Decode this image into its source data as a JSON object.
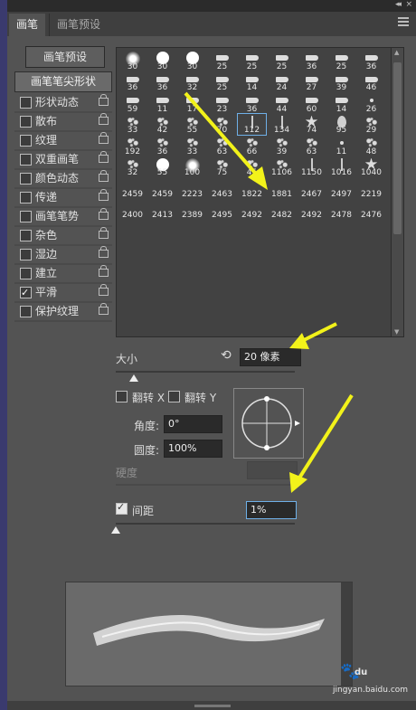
{
  "window": {
    "collapse_glyph": "◂◂",
    "close_glyph": "×"
  },
  "tabs": [
    {
      "label": "画笔",
      "active": true
    },
    {
      "label": "画笔预设",
      "active": false
    }
  ],
  "preset_button": "画笔预设",
  "sidebar": {
    "header": "画笔笔尖形状",
    "items": [
      {
        "label": "形状动态",
        "checked": false
      },
      {
        "label": "散布",
        "checked": false
      },
      {
        "label": "纹理",
        "checked": false
      },
      {
        "label": "双重画笔",
        "checked": false
      },
      {
        "label": "颜色动态",
        "checked": false
      },
      {
        "label": "传递",
        "checked": false
      },
      {
        "label": "画笔笔势",
        "checked": false
      },
      {
        "label": "杂色",
        "checked": false
      },
      {
        "label": "湿边",
        "checked": false
      },
      {
        "label": "建立",
        "checked": false
      },
      {
        "label": "平滑",
        "checked": true
      },
      {
        "label": "保护纹理",
        "checked": false
      }
    ]
  },
  "brush_tips": [
    {
      "size": "30",
      "shape": "soft"
    },
    {
      "size": "30",
      "shape": "round"
    },
    {
      "size": "30",
      "shape": "round"
    },
    {
      "size": "25",
      "shape": "tip"
    },
    {
      "size": "25",
      "shape": "tip"
    },
    {
      "size": "25",
      "shape": "tip"
    },
    {
      "size": "36",
      "shape": "tip"
    },
    {
      "size": "25",
      "shape": "tip"
    },
    {
      "size": "36",
      "shape": "tip"
    },
    {
      "size": "36",
      "shape": "tip"
    },
    {
      "size": "36",
      "shape": "tip"
    },
    {
      "size": "32",
      "shape": "tip"
    },
    {
      "size": "25",
      "shape": "tip"
    },
    {
      "size": "14",
      "shape": "tip"
    },
    {
      "size": "24",
      "shape": "tip"
    },
    {
      "size": "27",
      "shape": "tip"
    },
    {
      "size": "39",
      "shape": "tip"
    },
    {
      "size": "46",
      "shape": "tip"
    },
    {
      "size": "59",
      "shape": "tip"
    },
    {
      "size": "11",
      "shape": "tip"
    },
    {
      "size": "17",
      "shape": "tip"
    },
    {
      "size": "23",
      "shape": "tip"
    },
    {
      "size": "36",
      "shape": "tip"
    },
    {
      "size": "44",
      "shape": "tip"
    },
    {
      "size": "60",
      "shape": "tip"
    },
    {
      "size": "14",
      "shape": "tip"
    },
    {
      "size": "26",
      "shape": "dot"
    },
    {
      "size": "33",
      "shape": "splat"
    },
    {
      "size": "42",
      "shape": "splat"
    },
    {
      "size": "55",
      "shape": "splat"
    },
    {
      "size": "70",
      "shape": "splat"
    },
    {
      "size": "112",
      "shape": "line"
    },
    {
      "size": "134",
      "shape": "line"
    },
    {
      "size": "74",
      "shape": "star"
    },
    {
      "size": "95",
      "shape": "leaf"
    },
    {
      "size": "29",
      "shape": "splat"
    },
    {
      "size": "192",
      "shape": "splat"
    },
    {
      "size": "36",
      "shape": "splat"
    },
    {
      "size": "33",
      "shape": "splat"
    },
    {
      "size": "63",
      "shape": "splat"
    },
    {
      "size": "66",
      "shape": "splat"
    },
    {
      "size": "39",
      "shape": "splat"
    },
    {
      "size": "63",
      "shape": "splat"
    },
    {
      "size": "11",
      "shape": "dot"
    },
    {
      "size": "48",
      "shape": "splat"
    },
    {
      "size": "32",
      "shape": "splat"
    },
    {
      "size": "55",
      "shape": "round"
    },
    {
      "size": "100",
      "shape": "soft"
    },
    {
      "size": "75",
      "shape": "splat"
    },
    {
      "size": "45",
      "shape": "splat"
    },
    {
      "size": "1106",
      "shape": "splat"
    },
    {
      "size": "1150",
      "shape": "line"
    },
    {
      "size": "1016",
      "shape": "line"
    },
    {
      "size": "1040",
      "shape": "star"
    },
    {
      "size": "2459",
      "shape": "none"
    },
    {
      "size": "2459",
      "shape": "none"
    },
    {
      "size": "2223",
      "shape": "none"
    },
    {
      "size": "2463",
      "shape": "none"
    },
    {
      "size": "1822",
      "shape": "none"
    },
    {
      "size": "1881",
      "shape": "none"
    },
    {
      "size": "2467",
      "shape": "none"
    },
    {
      "size": "2497",
      "shape": "none"
    },
    {
      "size": "2219",
      "shape": "none"
    },
    {
      "size": "2400",
      "shape": "none"
    },
    {
      "size": "2413",
      "shape": "none"
    },
    {
      "size": "2389",
      "shape": "none"
    },
    {
      "size": "2495",
      "shape": "none"
    },
    {
      "size": "2492",
      "shape": "none"
    },
    {
      "size": "2482",
      "shape": "none"
    },
    {
      "size": "2492",
      "shape": "none"
    },
    {
      "size": "2478",
      "shape": "none"
    },
    {
      "size": "2476",
      "shape": "none"
    }
  ],
  "brush_tip_selected_size": "112",
  "settings": {
    "size_label": "大小",
    "size_value": "20 像素",
    "size_slider_fraction": 0.1,
    "flip_x_label": "翻转 X",
    "flip_y_label": "翻转 Y",
    "angle_label": "角度:",
    "angle_value": "0°",
    "roundness_label": "圆度:",
    "roundness_value": "100%",
    "hardness_label": "硬度",
    "spacing_label": "间距",
    "spacing_checked": true,
    "spacing_value": "1%",
    "spacing_slider_fraction": 0.0
  },
  "watermark": {
    "brand": "du",
    "site": "jingyan.baidu.com"
  },
  "colors": {
    "panel": "#535353",
    "annotation_arrow": "#f2f21a",
    "selected_outline": "#6fb0e8"
  }
}
